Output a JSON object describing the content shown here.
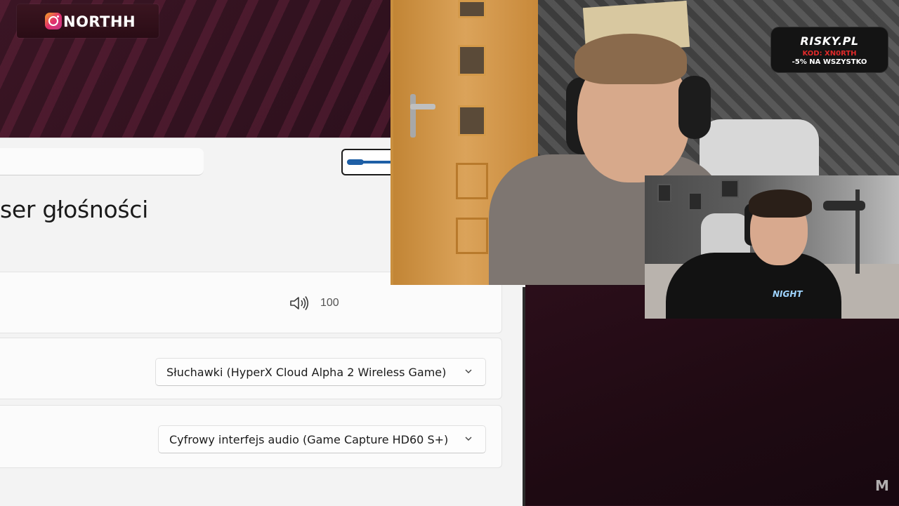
{
  "overlay": {
    "instagram_handle": "NORTHH",
    "sponsor": {
      "brand": "RISKY.PL",
      "code": "KOD: XN0RTH",
      "promo": "-5% NA WSZYSTKO"
    },
    "watermark": "M",
    "small_cam_shirt_text": "NIGHT"
  },
  "settings": {
    "page_title": "ser głośności",
    "volume": {
      "icon": "speaker-icon",
      "value_text": "100",
      "level_fraction": 1.0
    },
    "output_device": {
      "selected": "Słuchawki (HyperX Cloud Alpha 2 Wireless Game)"
    },
    "input_device": {
      "selected": "Cyfrowy interfejs audio (Game Capture HD60 S+)"
    }
  },
  "colors": {
    "accent": "#1e5fa6",
    "background": "#2a0f1b",
    "sponsor_red": "#e02a2a"
  }
}
